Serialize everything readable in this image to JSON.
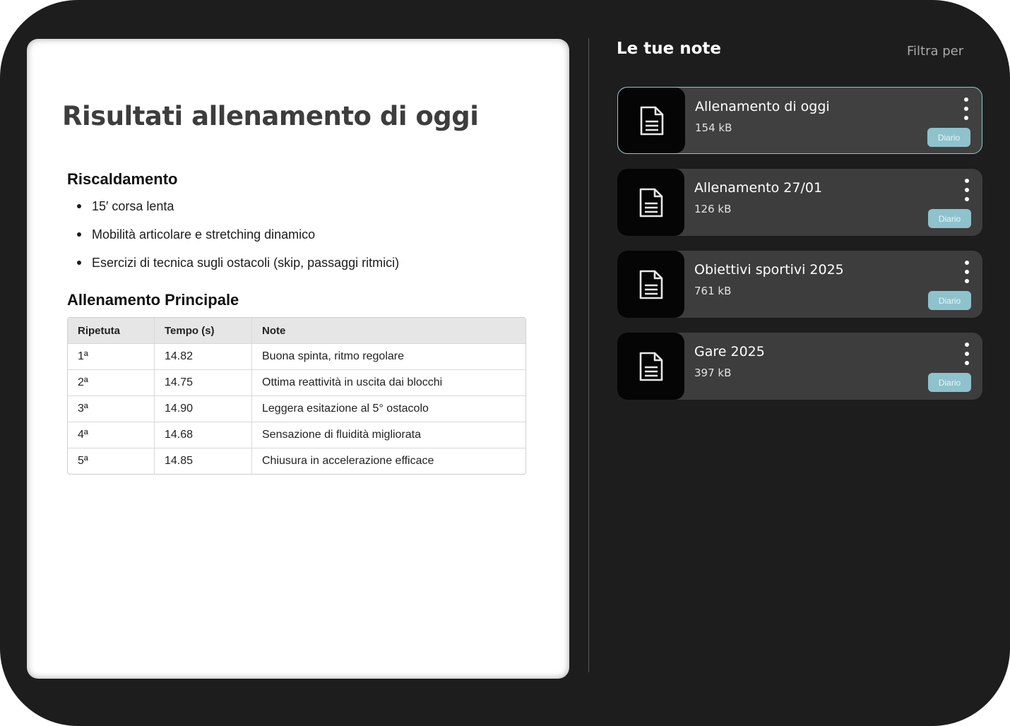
{
  "document": {
    "title": "Risultati allenamento di oggi",
    "warmup": {
      "heading": "Riscaldamento",
      "items": [
        "15′ corsa lenta",
        "Mobilità articolare e stretching dinamico",
        "Esercizi di tecnica sugli ostacoli (skip, passaggi ritmici)"
      ]
    },
    "main": {
      "heading": "Allenamento Principale",
      "table": {
        "headers": [
          "Ripetuta",
          "Tempo (s)",
          "Note"
        ],
        "rows": [
          [
            "1ª",
            "14.82",
            "Buona spinta, ritmo regolare"
          ],
          [
            "2ª",
            "14.75",
            "Ottima reattività in uscita dai blocchi"
          ],
          [
            "3ª",
            "14.90",
            "Leggera esitazione al 5° ostacolo"
          ],
          [
            "4ª",
            "14.68",
            "Sensazione di fluidità migliorata"
          ],
          [
            "5ª",
            "14.85",
            "Chiusura in accelerazione efficace"
          ]
        ]
      }
    }
  },
  "notes_panel": {
    "title": "Le tue note",
    "filter_label": "Filtra per",
    "icon": "document-icon",
    "accent_color": "#8ec2cc",
    "notes": [
      {
        "title": "Allenamento di oggi",
        "size": "154 kB",
        "tag": "Diario",
        "selected": true
      },
      {
        "title": "Allenamento 27/01",
        "size": "126 kB",
        "tag": "Diario",
        "selected": false
      },
      {
        "title": "Obiettivi sportivi 2025",
        "size": "761 kB",
        "tag": "Diario",
        "selected": false
      },
      {
        "title": "Gare 2025",
        "size": "397 kB",
        "tag": "Diario",
        "selected": false
      }
    ]
  }
}
